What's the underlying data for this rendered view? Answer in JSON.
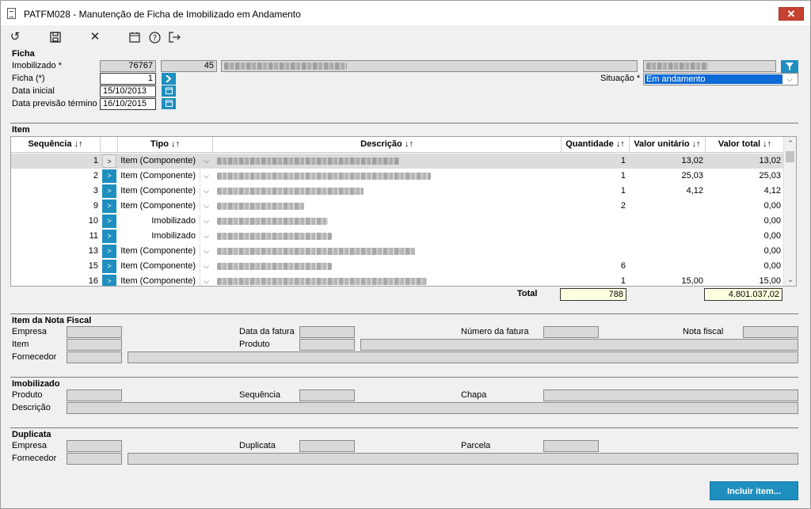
{
  "window": {
    "title": "PATFM028 - Manutenção de Ficha de Imobilizado em Andamento",
    "close_label": "✕"
  },
  "toolbar": {
    "refresh_icon": "↺",
    "save_icon": "save-icon",
    "cancel_icon": "✕",
    "calendar_icon": "calendar-icon",
    "help_icon": "?",
    "exit_icon": "exit-icon"
  },
  "ficha": {
    "section_title": "Ficha",
    "imobilizado_label": "Imobilizado *",
    "imobilizado_value": "76767",
    "imobilizado_code": "45",
    "ficha_label": "Ficha (*)",
    "ficha_value": "1",
    "data_inicial_label": "Data inicial",
    "data_inicial_value": "15/10/2013",
    "data_prev_label": "Data previsão término",
    "data_prev_value": "16/10/2015",
    "situacao_label": "Situação *",
    "situacao_value": "Em andamento"
  },
  "item": {
    "section_title": "Item",
    "columns": {
      "sequencia": "Sequência ↓↑",
      "tipo": "Tipo ↓↑",
      "descricao": "Descrição ↓↑",
      "quantidade": "Quantidade ↓↑",
      "valor_unitario": "Valor unitário ↓↑",
      "valor_total": "Valor total ↓↑"
    },
    "rows": [
      {
        "seq": "1",
        "tipo": "Item (Componente)",
        "qtd": "1",
        "vunit": "13,02",
        "vtotal": "13,02",
        "arrow": ">"
      },
      {
        "seq": "2",
        "tipo": "Item (Componente)",
        "qtd": "1",
        "vunit": "25,03",
        "vtotal": "25,03",
        "arrow": ">"
      },
      {
        "seq": "3",
        "tipo": "Item (Componente)",
        "qtd": "1",
        "vunit": "4,12",
        "vtotal": "4,12",
        "arrow": ">"
      },
      {
        "seq": "9",
        "tipo": "Item (Componente)",
        "qtd": "2",
        "vunit": "",
        "vtotal": "0,00",
        "arrow": ">"
      },
      {
        "seq": "10",
        "tipo": "Imobilizado",
        "qtd": "",
        "vunit": "",
        "vtotal": "0,00",
        "arrow": ">"
      },
      {
        "seq": "11",
        "tipo": "Imobilizado",
        "qtd": "",
        "vunit": "",
        "vtotal": "0,00",
        "arrow": ">"
      },
      {
        "seq": "13",
        "tipo": "Item (Componente)",
        "qtd": "",
        "vunit": "",
        "vtotal": "0,00",
        "arrow": ">"
      },
      {
        "seq": "15",
        "tipo": "Item (Componente)",
        "qtd": "6",
        "vunit": "",
        "vtotal": "0,00",
        "arrow": ">"
      },
      {
        "seq": "16",
        "tipo": "Item (Componente)",
        "qtd": "1",
        "vunit": "15,00",
        "vtotal": "15,00",
        "arrow": ">"
      }
    ],
    "total_label": "Total",
    "total_qtd": "788",
    "total_valor": "4.801.037,02"
  },
  "nota_fiscal": {
    "section_title": "Item da Nota Fiscal",
    "empresa_label": "Empresa",
    "data_fatura_label": "Data da fatura",
    "numero_fatura_label": "Número da fatura",
    "nota_fiscal_label": "Nota fiscal",
    "item_label": "Item",
    "produto_label": "Produto",
    "fornecedor_label": "Fornecedor"
  },
  "imobilizado": {
    "section_title": "Imobilizado",
    "produto_label": "Produto",
    "sequencia_label": "Sequência",
    "chapa_label": "Chapa",
    "descricao_label": "Descrição"
  },
  "duplicata": {
    "section_title": "Duplicata",
    "empresa_label": "Empresa",
    "duplicata_label": "Duplicata",
    "parcela_label": "Parcela",
    "fornecedor_label": "Fornecedor"
  },
  "actions": {
    "incluir_label": "Incluir item..."
  },
  "colors": {
    "accent": "#1e8fbf",
    "close": "#c84031",
    "highlight_field": "#ffffe1"
  }
}
